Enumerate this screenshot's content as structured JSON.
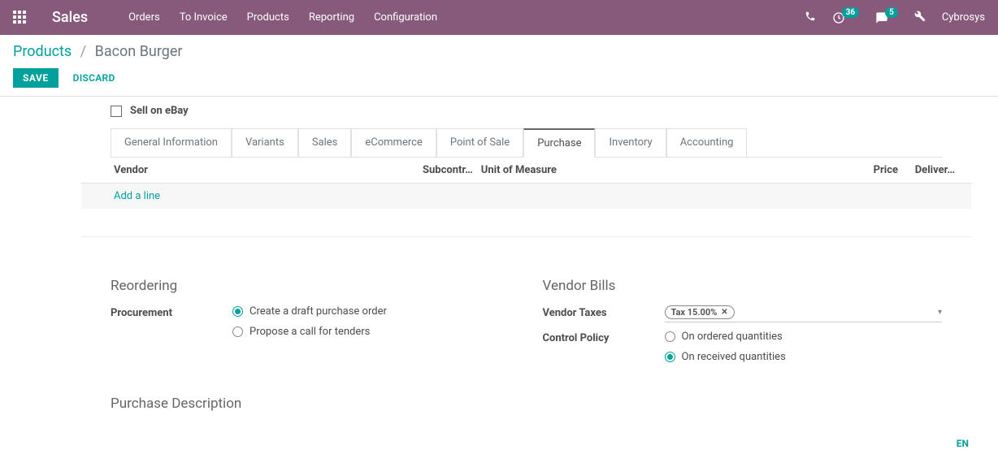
{
  "nav": {
    "brand": "Sales",
    "items": [
      "Orders",
      "To Invoice",
      "Products",
      "Reporting",
      "Configuration"
    ],
    "badge1": "36",
    "badge2": "5",
    "user": "Cybrosys"
  },
  "breadcrumb": {
    "parent": "Products",
    "current": "Bacon Burger"
  },
  "actions": {
    "save": "SAVE",
    "discard": "DISCARD"
  },
  "ebay": {
    "label": "Sell on eBay"
  },
  "tabs": [
    "General Information",
    "Variants",
    "Sales",
    "eCommerce",
    "Point of Sale",
    "Purchase",
    "Inventory",
    "Accounting"
  ],
  "active_tab": "Purchase",
  "vendor_table": {
    "headers": {
      "vendor": "Vendor",
      "subcontr": "Subcontr…",
      "uom": "Unit of Measure",
      "price": "Price",
      "deliver": "Deliver…"
    },
    "add_line": "Add a line"
  },
  "reordering": {
    "title": "Reordering",
    "procurement_label": "Procurement",
    "option1": "Create a draft purchase order",
    "option2": "Propose a call for tenders"
  },
  "vendor_bills": {
    "title": "Vendor Bills",
    "taxes_label": "Vendor Taxes",
    "tax_tag": "Tax 15.00%",
    "control_label": "Control Policy",
    "option1": "On ordered quantities",
    "option2": "On received quantities"
  },
  "purchase_desc": {
    "title": "Purchase Description"
  },
  "lang": "EN"
}
